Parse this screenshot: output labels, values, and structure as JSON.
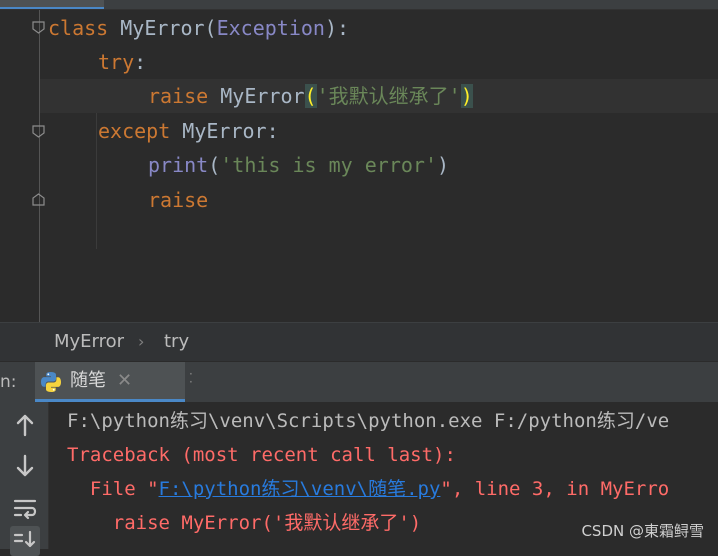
{
  "editor": {
    "lines": {
      "l1": {
        "kw": "class",
        "name": " MyError(",
        "base": "Exception",
        "end": "):"
      },
      "l2": {
        "kw": "try",
        "end": ":"
      },
      "l3": {
        "kw": "raise",
        "name": " MyError",
        "open": "(",
        "str": "'我默认继承了'",
        "close": ")"
      },
      "l4": {
        "kw": "except",
        "name": " MyError:"
      },
      "l5": {
        "fn": "print",
        "open": "(",
        "str": "'this is my error'",
        "close": ")"
      },
      "l6": {
        "kw": "raise"
      }
    }
  },
  "breadcrumb": {
    "item1": "MyError",
    "separator": "›",
    "item2": "try"
  },
  "run": {
    "label": "n:",
    "tab_label": "随笔",
    "close_glyph": "✕"
  },
  "console": {
    "line1": "F:\\python练习\\venv\\Scripts\\python.exe F:/python练习/ve",
    "line2": "Traceback (most recent call last):",
    "line3_pre": "  File \"",
    "line3_link": "F:\\python练习\\venv\\随笔.py",
    "line3_post": "\", line 3, in MyErro",
    "line4": "    raise MyError('我默认继承了')"
  },
  "watermark": "CSDN @東霜鲟雪",
  "colors": {
    "keyword": "#cc7832",
    "string": "#6a8759",
    "builtin": "#8888c6",
    "error_text": "#ff6b68",
    "link": "#287bde",
    "editor_bg": "#2b2b2b"
  }
}
